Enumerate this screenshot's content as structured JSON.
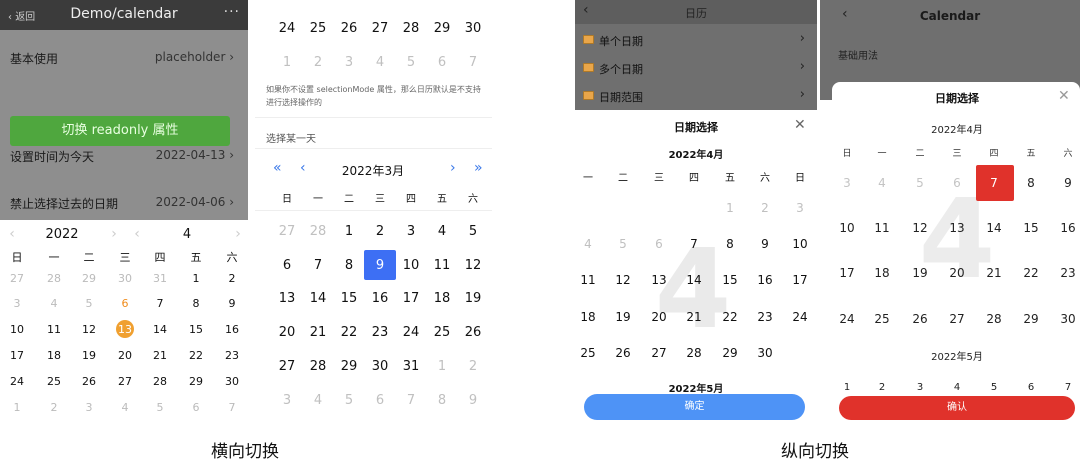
{
  "captions": {
    "horizontal": "横向切换",
    "vertical": "纵向切换"
  },
  "colors": {
    "green": "#4fa73e",
    "blue": "#3d6ff4",
    "orange": "#f0a030",
    "red": "#e0322b",
    "light_blue": "#4e93f6"
  },
  "shot1": {
    "nav": {
      "back": "返回",
      "title": "Demo/calendar",
      "more": "···"
    },
    "rows": [
      {
        "label": "基本使用",
        "value": "placeholder"
      },
      {
        "label": "设置时间为今天",
        "value": "2022-04-13"
      },
      {
        "label": "禁止选择过去的日期",
        "value": "2022-04-06"
      }
    ],
    "button": "切换 readonly 属性",
    "picker": {
      "year": "2022",
      "month": "4"
    },
    "weekdays": [
      "日",
      "一",
      "二",
      "三",
      "四",
      "五",
      "六"
    ],
    "weeks": [
      [
        "27",
        "28",
        "29",
        "30",
        "31",
        "1",
        "2"
      ],
      [
        "3",
        "4",
        "5",
        "6",
        "7",
        "8",
        "9"
      ],
      [
        "10",
        "11",
        "12",
        "13",
        "14",
        "15",
        "16"
      ],
      [
        "17",
        "18",
        "19",
        "20",
        "21",
        "22",
        "23"
      ],
      [
        "24",
        "25",
        "26",
        "27",
        "28",
        "29",
        "30"
      ],
      [
        "1",
        "2",
        "3",
        "4",
        "5",
        "6",
        "7"
      ]
    ]
  },
  "shot2": {
    "top_weeks": [
      [
        "24",
        "25",
        "26",
        "27",
        "28",
        "29",
        "30"
      ],
      [
        "1",
        "2",
        "3",
        "4",
        "5",
        "6",
        "7"
      ]
    ],
    "note": "如果你不设置 selectionMode 属性，那么日历默认是不支持进行选择操作的",
    "section": "选择某一天",
    "month": "2022年3月",
    "weekdays": [
      "日",
      "一",
      "二",
      "三",
      "四",
      "五",
      "六"
    ],
    "weeks": [
      [
        "27",
        "28",
        "1",
        "2",
        "3",
        "4",
        "5"
      ],
      [
        "6",
        "7",
        "8",
        "9",
        "10",
        "11",
        "12"
      ],
      [
        "13",
        "14",
        "15",
        "16",
        "17",
        "18",
        "19"
      ],
      [
        "20",
        "21",
        "22",
        "23",
        "24",
        "25",
        "26"
      ],
      [
        "27",
        "28",
        "29",
        "30",
        "31",
        "1",
        "2"
      ],
      [
        "3",
        "4",
        "5",
        "6",
        "7",
        "8",
        "9"
      ]
    ]
  },
  "shot3": {
    "nav_title": "日历",
    "menu": [
      "单个日期",
      "多个日期",
      "日期范围"
    ],
    "panel_title": "日期选择",
    "month_label": "2022年4月",
    "next_month_label": "2022年5月",
    "weekdays": [
      "一",
      "二",
      "三",
      "四",
      "五",
      "六",
      "日"
    ],
    "watermark": "4",
    "weeks": [
      [
        "",
        "",
        "",
        "",
        "1",
        "2",
        "3"
      ],
      [
        "4",
        "5",
        "6",
        "7",
        "8",
        "9",
        "10"
      ],
      [
        "11",
        "12",
        "13",
        "14",
        "15",
        "16",
        "17"
      ],
      [
        "18",
        "19",
        "20",
        "21",
        "22",
        "23",
        "24"
      ],
      [
        "25",
        "26",
        "27",
        "28",
        "29",
        "30",
        ""
      ]
    ],
    "confirm": "确定"
  },
  "shot4": {
    "nav_title": "Calendar",
    "subtitle": "基础用法",
    "panel_title": "日期选择",
    "month_label": "2022年4月",
    "next_month_label": "2022年5月",
    "weekdays": [
      "日",
      "一",
      "二",
      "三",
      "四",
      "五",
      "六"
    ],
    "watermark": "4",
    "weeks": [
      [
        "3",
        "4",
        "5",
        "6",
        "7",
        "8",
        "9"
      ],
      [
        "10",
        "11",
        "12",
        "13",
        "14",
        "15",
        "16"
      ],
      [
        "17",
        "18",
        "19",
        "20",
        "21",
        "22",
        "23"
      ],
      [
        "24",
        "25",
        "26",
        "27",
        "28",
        "29",
        "30"
      ]
    ],
    "partial_row": [
      "1",
      "2",
      "3",
      "4",
      "5",
      "6",
      "7"
    ],
    "confirm": "确认"
  }
}
